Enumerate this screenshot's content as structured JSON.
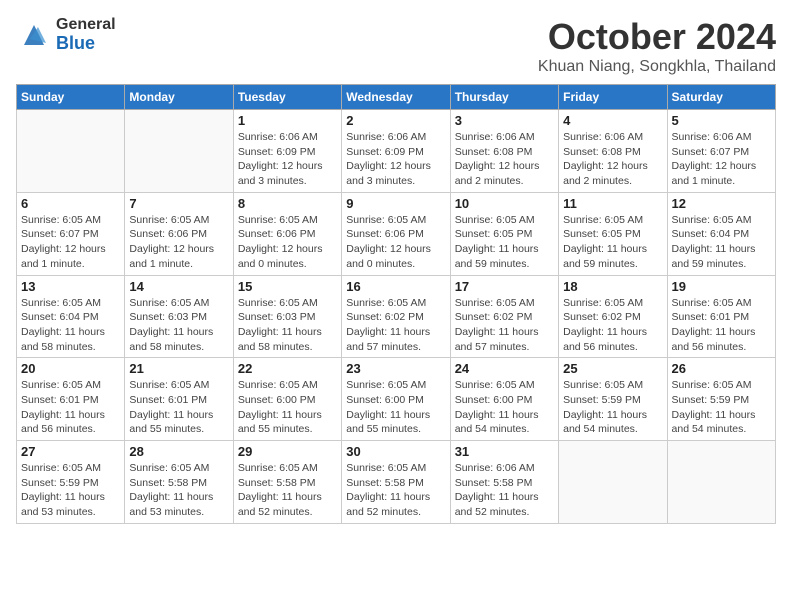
{
  "header": {
    "logo_general": "General",
    "logo_blue": "Blue",
    "month_title": "October 2024",
    "subtitle": "Khuan Niang, Songkhla, Thailand"
  },
  "weekdays": [
    "Sunday",
    "Monday",
    "Tuesday",
    "Wednesday",
    "Thursday",
    "Friday",
    "Saturday"
  ],
  "weeks": [
    [
      {
        "day": "",
        "info": ""
      },
      {
        "day": "",
        "info": ""
      },
      {
        "day": "1",
        "info": "Sunrise: 6:06 AM\nSunset: 6:09 PM\nDaylight: 12 hours and 3 minutes."
      },
      {
        "day": "2",
        "info": "Sunrise: 6:06 AM\nSunset: 6:09 PM\nDaylight: 12 hours and 3 minutes."
      },
      {
        "day": "3",
        "info": "Sunrise: 6:06 AM\nSunset: 6:08 PM\nDaylight: 12 hours and 2 minutes."
      },
      {
        "day": "4",
        "info": "Sunrise: 6:06 AM\nSunset: 6:08 PM\nDaylight: 12 hours and 2 minutes."
      },
      {
        "day": "5",
        "info": "Sunrise: 6:06 AM\nSunset: 6:07 PM\nDaylight: 12 hours and 1 minute."
      }
    ],
    [
      {
        "day": "6",
        "info": "Sunrise: 6:05 AM\nSunset: 6:07 PM\nDaylight: 12 hours and 1 minute."
      },
      {
        "day": "7",
        "info": "Sunrise: 6:05 AM\nSunset: 6:06 PM\nDaylight: 12 hours and 1 minute."
      },
      {
        "day": "8",
        "info": "Sunrise: 6:05 AM\nSunset: 6:06 PM\nDaylight: 12 hours and 0 minutes."
      },
      {
        "day": "9",
        "info": "Sunrise: 6:05 AM\nSunset: 6:06 PM\nDaylight: 12 hours and 0 minutes."
      },
      {
        "day": "10",
        "info": "Sunrise: 6:05 AM\nSunset: 6:05 PM\nDaylight: 11 hours and 59 minutes."
      },
      {
        "day": "11",
        "info": "Sunrise: 6:05 AM\nSunset: 6:05 PM\nDaylight: 11 hours and 59 minutes."
      },
      {
        "day": "12",
        "info": "Sunrise: 6:05 AM\nSunset: 6:04 PM\nDaylight: 11 hours and 59 minutes."
      }
    ],
    [
      {
        "day": "13",
        "info": "Sunrise: 6:05 AM\nSunset: 6:04 PM\nDaylight: 11 hours and 58 minutes."
      },
      {
        "day": "14",
        "info": "Sunrise: 6:05 AM\nSunset: 6:03 PM\nDaylight: 11 hours and 58 minutes."
      },
      {
        "day": "15",
        "info": "Sunrise: 6:05 AM\nSunset: 6:03 PM\nDaylight: 11 hours and 58 minutes."
      },
      {
        "day": "16",
        "info": "Sunrise: 6:05 AM\nSunset: 6:02 PM\nDaylight: 11 hours and 57 minutes."
      },
      {
        "day": "17",
        "info": "Sunrise: 6:05 AM\nSunset: 6:02 PM\nDaylight: 11 hours and 57 minutes."
      },
      {
        "day": "18",
        "info": "Sunrise: 6:05 AM\nSunset: 6:02 PM\nDaylight: 11 hours and 56 minutes."
      },
      {
        "day": "19",
        "info": "Sunrise: 6:05 AM\nSunset: 6:01 PM\nDaylight: 11 hours and 56 minutes."
      }
    ],
    [
      {
        "day": "20",
        "info": "Sunrise: 6:05 AM\nSunset: 6:01 PM\nDaylight: 11 hours and 56 minutes."
      },
      {
        "day": "21",
        "info": "Sunrise: 6:05 AM\nSunset: 6:01 PM\nDaylight: 11 hours and 55 minutes."
      },
      {
        "day": "22",
        "info": "Sunrise: 6:05 AM\nSunset: 6:00 PM\nDaylight: 11 hours and 55 minutes."
      },
      {
        "day": "23",
        "info": "Sunrise: 6:05 AM\nSunset: 6:00 PM\nDaylight: 11 hours and 55 minutes."
      },
      {
        "day": "24",
        "info": "Sunrise: 6:05 AM\nSunset: 6:00 PM\nDaylight: 11 hours and 54 minutes."
      },
      {
        "day": "25",
        "info": "Sunrise: 6:05 AM\nSunset: 5:59 PM\nDaylight: 11 hours and 54 minutes."
      },
      {
        "day": "26",
        "info": "Sunrise: 6:05 AM\nSunset: 5:59 PM\nDaylight: 11 hours and 54 minutes."
      }
    ],
    [
      {
        "day": "27",
        "info": "Sunrise: 6:05 AM\nSunset: 5:59 PM\nDaylight: 11 hours and 53 minutes."
      },
      {
        "day": "28",
        "info": "Sunrise: 6:05 AM\nSunset: 5:58 PM\nDaylight: 11 hours and 53 minutes."
      },
      {
        "day": "29",
        "info": "Sunrise: 6:05 AM\nSunset: 5:58 PM\nDaylight: 11 hours and 52 minutes."
      },
      {
        "day": "30",
        "info": "Sunrise: 6:05 AM\nSunset: 5:58 PM\nDaylight: 11 hours and 52 minutes."
      },
      {
        "day": "31",
        "info": "Sunrise: 6:06 AM\nSunset: 5:58 PM\nDaylight: 11 hours and 52 minutes."
      },
      {
        "day": "",
        "info": ""
      },
      {
        "day": "",
        "info": ""
      }
    ]
  ]
}
